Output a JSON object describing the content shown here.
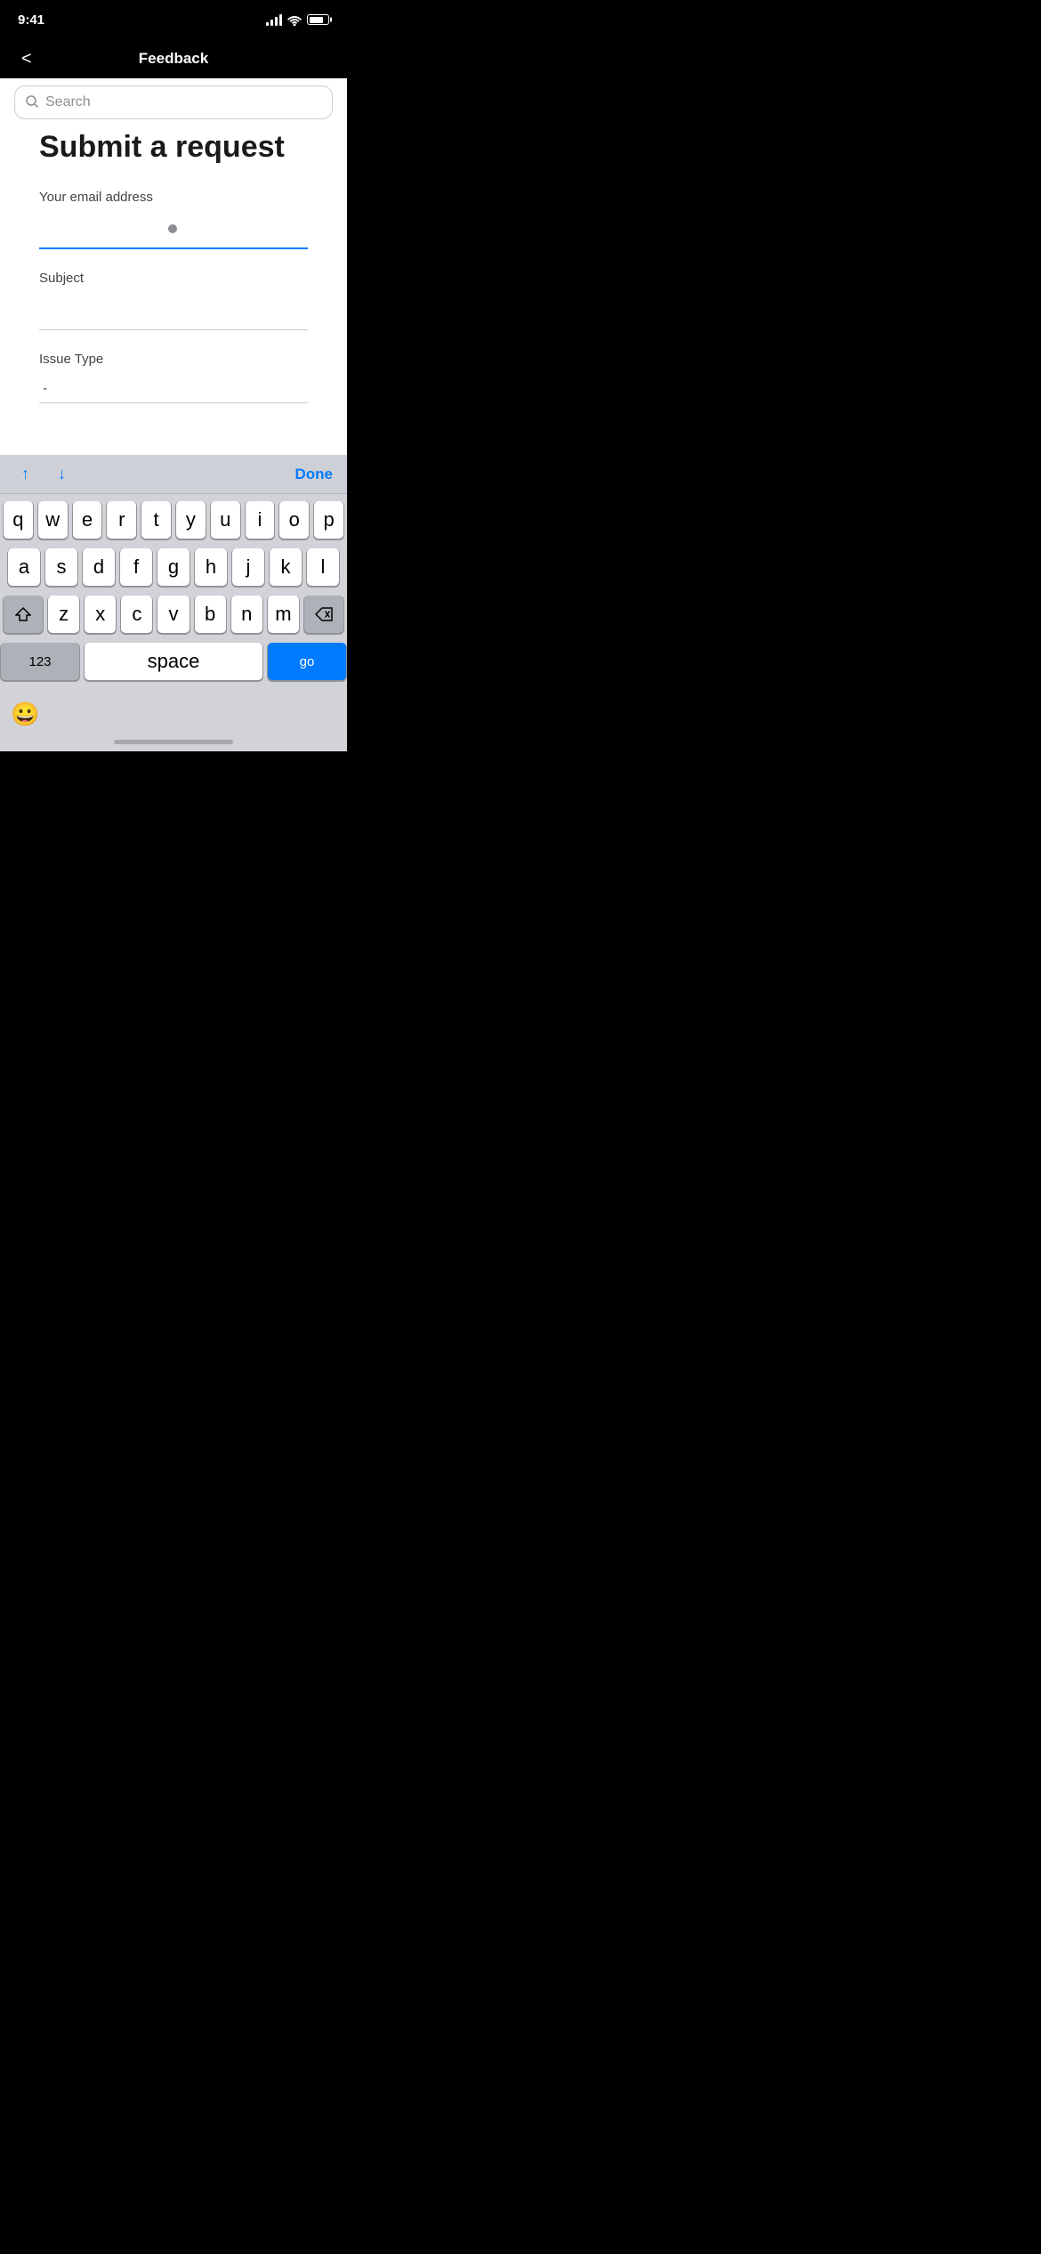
{
  "statusBar": {
    "time": "9:41",
    "signalLabel": "signal",
    "wifiLabel": "wifi",
    "batteryLabel": "battery"
  },
  "navBar": {
    "backLabel": "<",
    "title": "Feedback"
  },
  "content": {
    "searchPlaceholder": "Search",
    "formTitle": "Submit a request",
    "fields": [
      {
        "label": "Your email address",
        "value": "",
        "active": true
      },
      {
        "label": "Subject",
        "value": "",
        "active": false
      },
      {
        "label": "Issue Type",
        "value": "-",
        "active": false
      }
    ]
  },
  "keyboard": {
    "toolbar": {
      "upLabel": "↑",
      "downLabel": "↓",
      "doneLabel": "Done"
    },
    "rows": [
      [
        "q",
        "w",
        "e",
        "r",
        "t",
        "y",
        "u",
        "i",
        "o",
        "p"
      ],
      [
        "a",
        "s",
        "d",
        "f",
        "g",
        "h",
        "j",
        "k",
        "l"
      ],
      [
        "z",
        "x",
        "c",
        "v",
        "b",
        "n",
        "m"
      ]
    ],
    "bottomRow": {
      "numbersLabel": "123",
      "spaceLabel": "space",
      "goLabel": "go"
    },
    "emojiLabel": "😀"
  }
}
